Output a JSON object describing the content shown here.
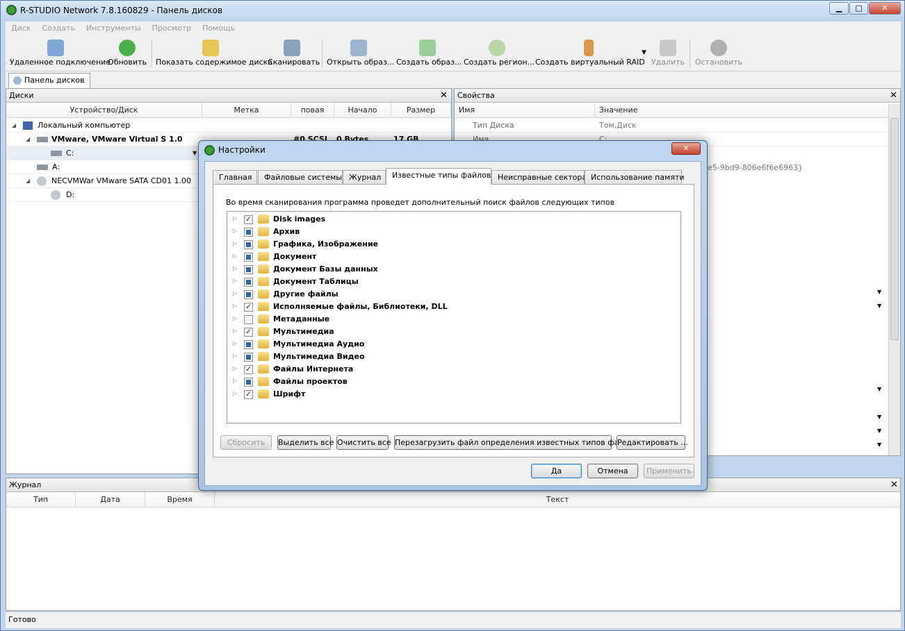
{
  "app": {
    "title": "R-STUDIO Network 7.8.160829 - Панель дисков"
  },
  "menu": [
    "Диск",
    "Создать",
    "Инструменты",
    "Просмотр",
    "Помощь"
  ],
  "toolbar": {
    "remote": "Удаленное подключение",
    "refresh": "Обновить",
    "show_contents": "Показать содержимое диска",
    "scan": "Сканировать",
    "open_image": "Открыть образ...",
    "create_image": "Создать образ...",
    "create_region": "Создать регион...",
    "create_raid": "Создать виртуальный RAID",
    "delete": "Удалить",
    "stop": "Остановить"
  },
  "doc_tab": "Панель дисков",
  "disks_panel": {
    "title": "Диски",
    "columns": [
      "Устройство/Диск",
      "Метка",
      "повая сист",
      "Начало",
      "Размер"
    ],
    "rows": [
      {
        "name": "Локальный компьютер",
        "fs": "",
        "start": "",
        "size": ""
      },
      {
        "name": "VMware, VMware Virtual S 1.0",
        "fs": "#0 SCSI",
        "start": "0 Bytes",
        "size": "17 GB"
      },
      {
        "name": "C:",
        "fs": "",
        "start": "",
        "size": ""
      },
      {
        "name": "A:",
        "fs": "",
        "start": "",
        "size": ""
      },
      {
        "name": "NECVMWar VMware SATA CD01 1.00",
        "fs": "",
        "start": "",
        "size": ""
      },
      {
        "name": "D:",
        "fs": "",
        "start": "",
        "size": ""
      }
    ]
  },
  "props_panel": {
    "title": "Свойства",
    "columns": [
      "Имя",
      "Значение"
    ],
    "rows": [
      {
        "name": "Тип Диска",
        "value": "Том,Диск"
      },
      {
        "name": "Имя",
        "value": "C:"
      }
    ],
    "guid_fragment": "e5-9bd9-806e6f6e6963}"
  },
  "journal_panel": {
    "title": "Журнал",
    "columns": [
      "Тип",
      "Дата",
      "Время",
      "Текст"
    ]
  },
  "status": "Готово",
  "dialog": {
    "title": "Настройки",
    "close": "✕",
    "tabs": [
      "Главная",
      "Файловые системы",
      "Журнал",
      "Известные типы файлов",
      "Неисправные сектора",
      "Использование памяти"
    ],
    "active_tab": "Известные типы файлов",
    "description": "Во время сканирования программа проведет дополнительный поиск файлов следующих типов",
    "file_types": [
      {
        "name": "Disk images",
        "state": "checked"
      },
      {
        "name": "Архив",
        "state": "partial"
      },
      {
        "name": "Графика, Изображение",
        "state": "partial"
      },
      {
        "name": "Документ",
        "state": "partial"
      },
      {
        "name": "Документ Базы данных",
        "state": "partial"
      },
      {
        "name": "Документ Таблицы",
        "state": "partial"
      },
      {
        "name": "Другие файлы",
        "state": "partial"
      },
      {
        "name": "Исполняемые файлы, Библиотеки, DLL",
        "state": "checked"
      },
      {
        "name": "Метаданные",
        "state": "unchecked"
      },
      {
        "name": "Мультимедиа",
        "state": "checked"
      },
      {
        "name": "Мультимедиа Аудио",
        "state": "partial"
      },
      {
        "name": "Мультимедиа Видео",
        "state": "partial"
      },
      {
        "name": "Файлы Интернета",
        "state": "checked"
      },
      {
        "name": "Файлы проектов",
        "state": "partial"
      },
      {
        "name": "Шрифт",
        "state": "checked"
      }
    ],
    "buttons": {
      "reset": "Сбросить",
      "select_all": "Выделить все",
      "clear_all": "Очистить все",
      "reload": "Перезагрузить файл определения известных типов файлов",
      "edit": "Редактировать ...",
      "ok": "Да",
      "cancel": "Отмена",
      "apply": "Применить"
    }
  },
  "colors": {
    "accent": "#3464a8",
    "title_bg": "#c2d5ec"
  }
}
